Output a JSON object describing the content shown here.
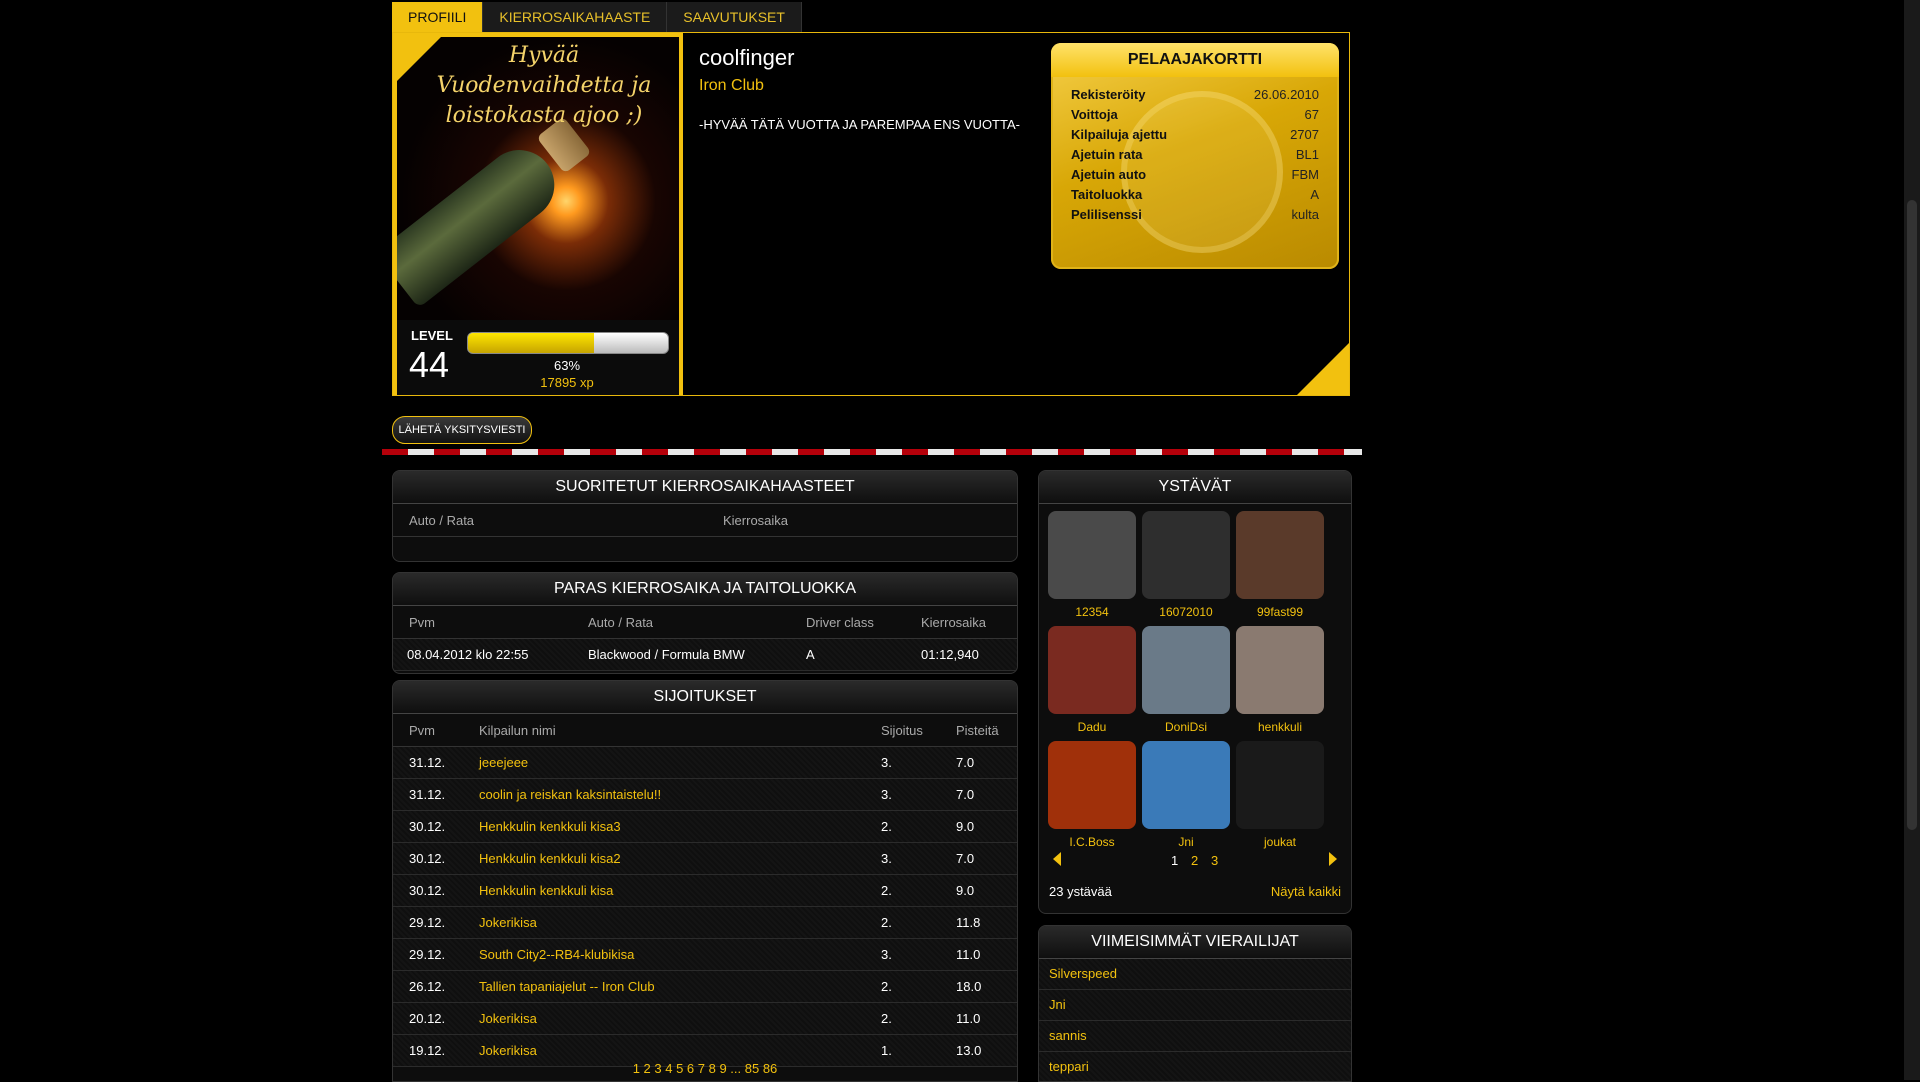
{
  "tabs": [
    "PROFIILI",
    "KIERROSAIKAHAASTE",
    "SAAVUTUKSET"
  ],
  "profile": {
    "avatar_text": "Hyvää Vuodenvaihdetta ja loistokasta ajoo ;)",
    "level_label": "LEVEL",
    "level": "44",
    "xp_percent": 63,
    "xp_percent_text": "63%",
    "xp_text": "17895 xp",
    "username": "coolfinger",
    "club": "Iron Club",
    "motto": "-HYVÄÄ TÄTÄ VUOTTA JA PAREMPAA ENS VUOTTA-"
  },
  "player_card": {
    "title": "PELAAJAKORTTI",
    "rows": [
      {
        "k": "Rekisteröity",
        "v": "26.06.2010"
      },
      {
        "k": "Voittoja",
        "v": "67"
      },
      {
        "k": "Kilpailuja ajettu",
        "v": "2707"
      },
      {
        "k": "Ajetuin rata",
        "v": "BL1"
      },
      {
        "k": "Ajetuin auto",
        "v": "FBM"
      },
      {
        "k": "Taitoluokka",
        "v": "A"
      },
      {
        "k": "Pelilisenssi",
        "v": "kulta"
      }
    ]
  },
  "private_message_button": "LÄHETÄ YKSITYSVIESTI",
  "completed": {
    "title": "SUORITETUT KIERROSAIKAHAASTEET",
    "col_car_track": "Auto / Rata",
    "col_laptime": "Kierrosaika"
  },
  "best": {
    "title": "PARAS KIERROSAIKA JA TAITOLUOKKA",
    "headers": [
      "Pvm",
      "Auto / Rata",
      "Driver class",
      "Kierrosaika"
    ],
    "row": [
      "08.04.2012 klo 22:55",
      "Blackwood / Formula BMW",
      "A",
      "01:12,940"
    ]
  },
  "placements": {
    "title": "SIJOITUKSET",
    "headers": [
      "Pvm",
      "Kilpailun nimi",
      "Sijoitus",
      "Pisteitä"
    ],
    "rows": [
      {
        "date": "31.12.",
        "name": "jeeejeee",
        "place": "3.",
        "points": "7.0"
      },
      {
        "date": "31.12.",
        "name": "coolin ja reiskan kaksintaistelu!!",
        "place": "3.",
        "points": "7.0"
      },
      {
        "date": "30.12.",
        "name": "Henkkulin kenkkuli kisa3",
        "place": "2.",
        "points": "9.0"
      },
      {
        "date": "30.12.",
        "name": "Henkkulin kenkkuli kisa2",
        "place": "3.",
        "points": "7.0"
      },
      {
        "date": "30.12.",
        "name": "Henkkulin kenkkuli kisa",
        "place": "2.",
        "points": "9.0"
      },
      {
        "date": "29.12.",
        "name": "Jokerikisa",
        "place": "2.",
        "points": "11.8"
      },
      {
        "date": "29.12.",
        "name": "South City2--RB4-klubikisa",
        "place": "3.",
        "points": "11.0"
      },
      {
        "date": "26.12.",
        "name": "Tallien tapaniajelut -- Iron Club",
        "place": "2.",
        "points": "18.0"
      },
      {
        "date": "20.12.",
        "name": "Jokerikisa",
        "place": "2.",
        "points": "11.0"
      },
      {
        "date": "19.12.",
        "name": "Jokerikisa",
        "place": "1.",
        "points": "13.0"
      }
    ],
    "pager": "1 2 3 4 5 6 7 8 9 ... 85 86"
  },
  "friends": {
    "title": "YSTÄVÄT",
    "list": [
      {
        "name": "12354",
        "color": "#4a4a4a"
      },
      {
        "name": "16072010",
        "color": "#2e2e2e"
      },
      {
        "name": "99fast99",
        "color": "#5a3a2a"
      },
      {
        "name": "Dadu",
        "color": "#7a2a20"
      },
      {
        "name": "DoniDsi",
        "color": "#6a7a88"
      },
      {
        "name": "henkkuli",
        "color": "#8a7a70"
      },
      {
        "name": "I.C.Boss",
        "color": "#a0300a"
      },
      {
        "name": "Jni",
        "color": "#3a7ab8"
      },
      {
        "name": "joukat",
        "color": "#1a1a1a"
      }
    ],
    "pages": [
      "1",
      "2",
      "3"
    ],
    "count": "23 ystävää",
    "show_all": "Näytä kaikki"
  },
  "visitors": {
    "title": "VIIMEISIMMÄT VIERAILIJAT",
    "list": [
      "Silverspeed",
      "Jni",
      "sannis",
      "teppari"
    ]
  },
  "colors": {
    "accent": "#f2c10f",
    "stripe_red": "#b5000a"
  }
}
